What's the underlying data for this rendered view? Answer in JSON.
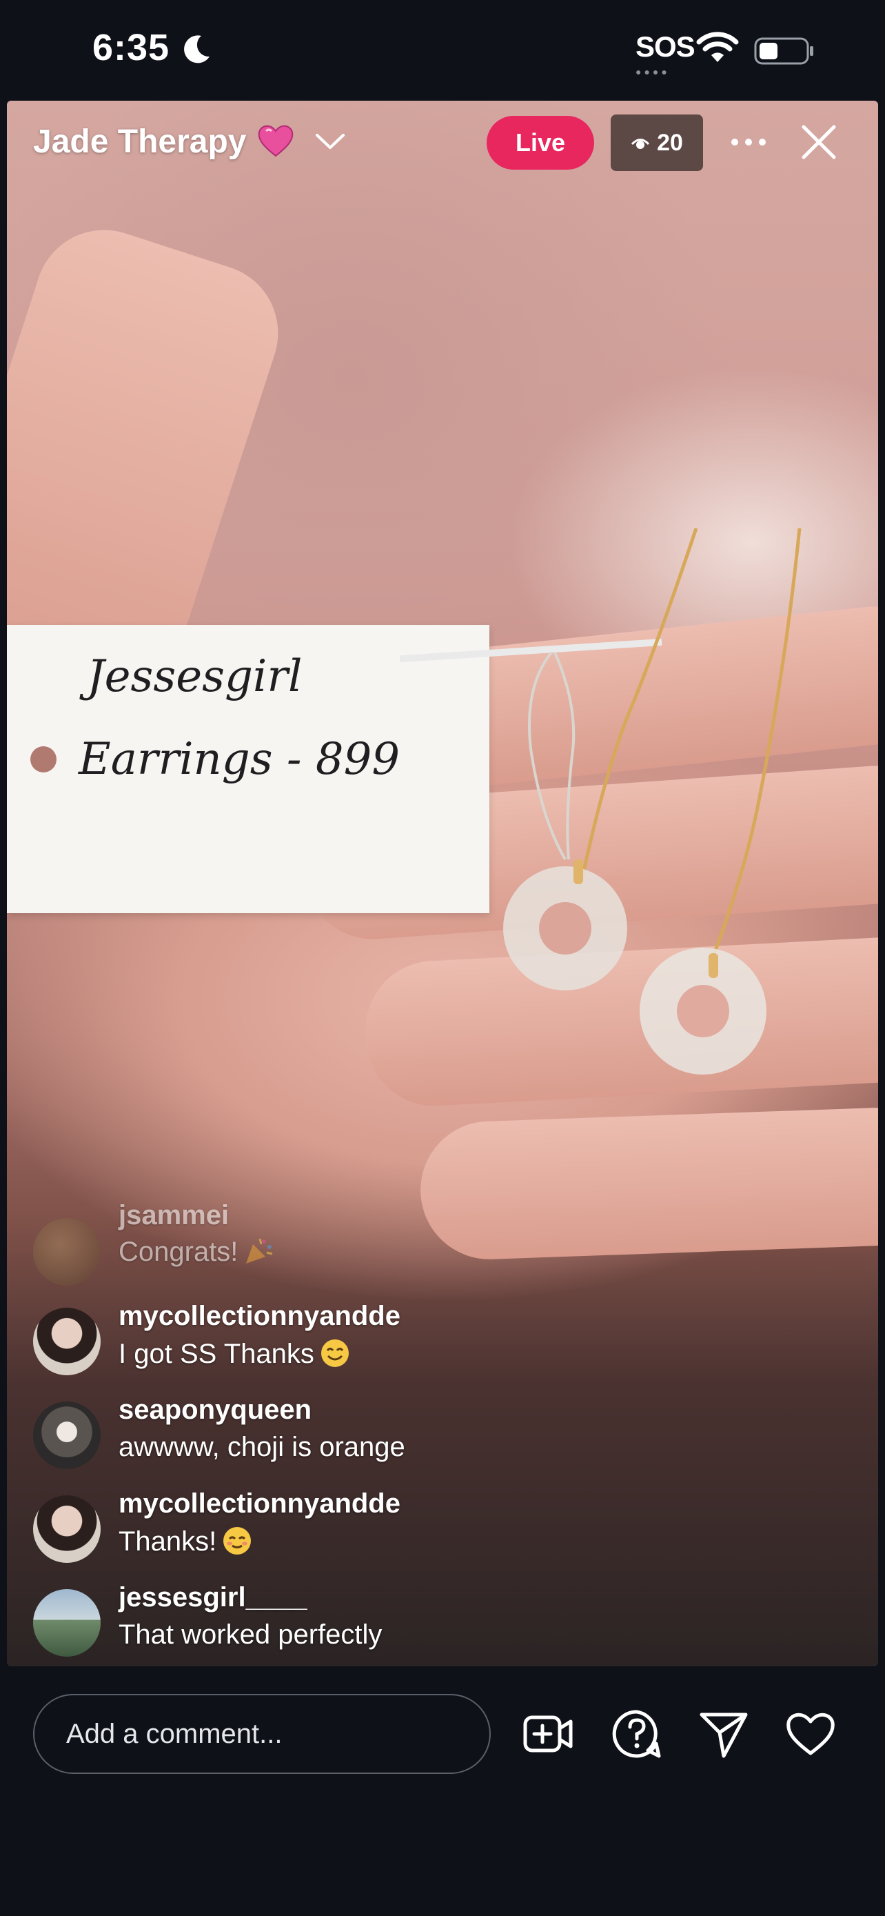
{
  "status_bar": {
    "time": "6:35",
    "carrier": "SOS"
  },
  "stream": {
    "title": "Jade Therapy",
    "live_label": "Live",
    "viewer_count": "20"
  },
  "price_tag": {
    "buyer": "Jessesgirl",
    "item": "Earrings  -  899"
  },
  "comments": [
    {
      "user": "jsammei",
      "text": "Congrats!",
      "emoji": "party-popper"
    },
    {
      "user": "mycollectionnyandde",
      "text": "I got SS Thanks",
      "emoji": "smiling-face"
    },
    {
      "user": "seaponyqueen",
      "text": "awwww, choji is orange",
      "emoji": ""
    },
    {
      "user": "mycollectionnyandde",
      "text": "Thanks!",
      "emoji": "blushing-face"
    },
    {
      "user": "jessesgirl____",
      "text": "That worked perfectly",
      "emoji": ""
    }
  ],
  "composer": {
    "placeholder": "Add a comment..."
  },
  "icons": {
    "add-video": "add-video-icon",
    "question": "question-icon",
    "share": "send-icon",
    "like": "heart-icon"
  },
  "colors": {
    "live": "#e8275f",
    "background": "#0e1118"
  }
}
